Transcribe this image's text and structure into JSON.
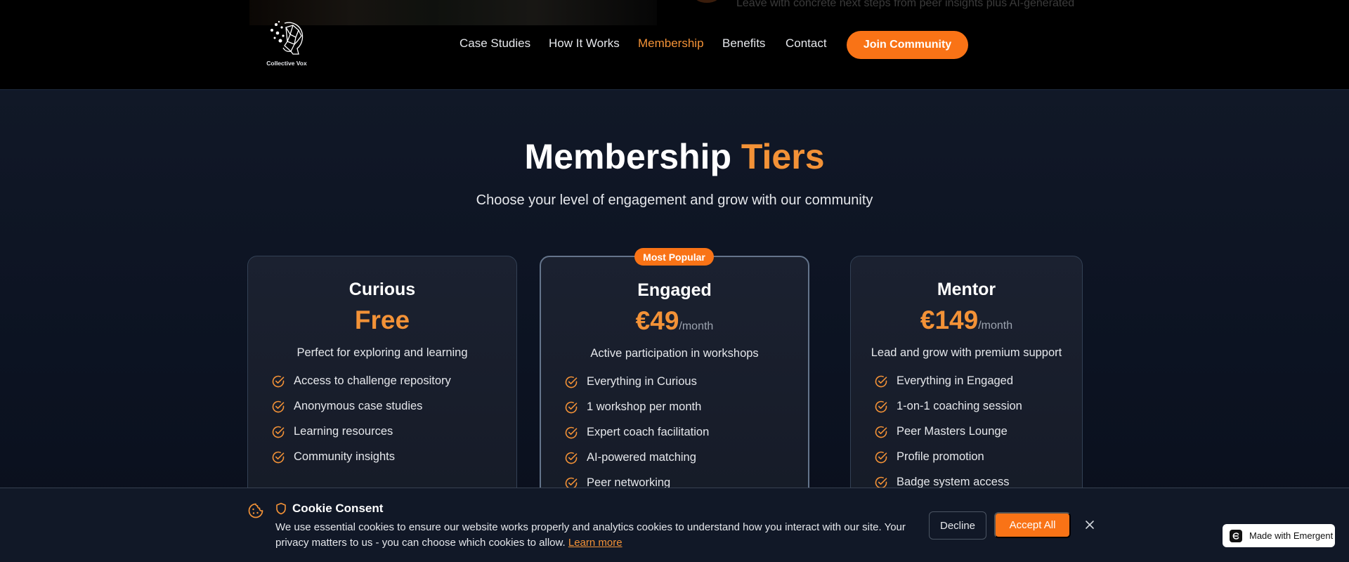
{
  "header": {
    "logo_text": "Collective Vox",
    "background_text": "Leave with concrete next steps from peer insights plus AI-generated",
    "nav": [
      {
        "label": "Case Studies",
        "active": false
      },
      {
        "label": "How It Works",
        "active": false
      },
      {
        "label": "Membership",
        "active": true
      },
      {
        "label": "Benefits",
        "active": false
      },
      {
        "label": "Contact",
        "active": false
      }
    ],
    "cta_label": "Join Community"
  },
  "section": {
    "title": "Membership",
    "title_accent": "Tiers",
    "subtitle": "Choose your level of engagement and grow with our community"
  },
  "tiers": [
    {
      "name": "Curious",
      "price": "Free",
      "period": "",
      "description": "Perfect for exploring and learning",
      "features": [
        "Access to challenge repository",
        "Anonymous case studies",
        "Learning resources",
        "Community insights"
      ]
    },
    {
      "name": "Engaged",
      "price": "€49",
      "period": "/month",
      "description": "Active participation in workshops",
      "badge": "Most Popular",
      "features": [
        "Everything in Curious",
        "1 workshop per month",
        "Expert coach facilitation",
        "AI-powered matching",
        "Peer networking"
      ]
    },
    {
      "name": "Mentor",
      "price": "€149",
      "period": "/month",
      "description": "Lead and grow with premium support",
      "features": [
        "Everything in Engaged",
        "1-on-1 coaching session",
        "Peer Masters Lounge",
        "Profile promotion",
        "Badge system access"
      ]
    }
  ],
  "cookie": {
    "title": "Cookie Consent",
    "text": "We use essential cookies to ensure our website works properly and analytics cookies to understand how you interact with our site. Your privacy matters to us - you can choose which cookies to allow.",
    "learn_more": "Learn more",
    "decline_label": "Decline",
    "accept_label": "Accept All"
  },
  "badge_emergent": "Made with Emergent",
  "colors": {
    "accent": "#f97316",
    "accent_text": "#f39237",
    "background": "#0f172a"
  }
}
